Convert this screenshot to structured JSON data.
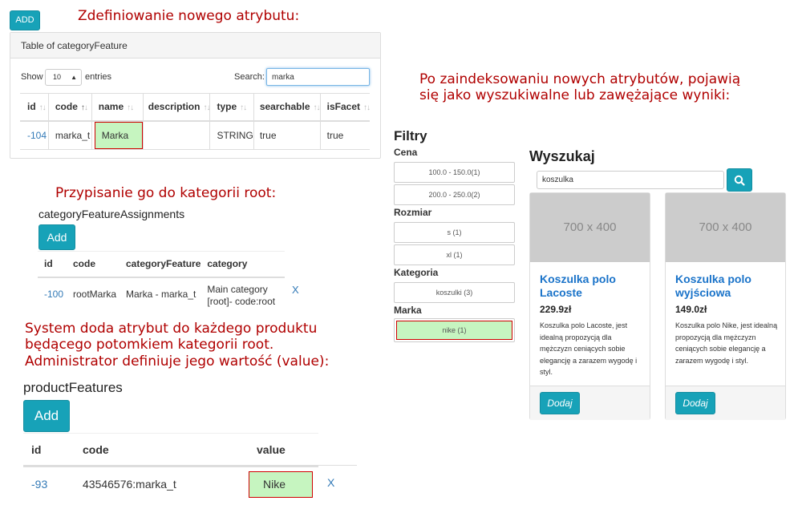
{
  "notes": {
    "define": "Zdefiniowanie nowego atrybutu:",
    "assign": "Przypisanie go do kategorii root:",
    "system_line1": "System doda atrybut do każdego produktu",
    "system_line2": "będącego potomkiem kategorii root.",
    "system_line3": "Administrator definiuje jego wartość (value):",
    "indexed_line1": "Po zaindeksowaniu nowych atrybutów, pojawią",
    "indexed_line2": "się jako wyszukiwalne lub zawężające wyniki:"
  },
  "category_feature": {
    "add_label": "ADD",
    "table_title": "Table of categoryFeature",
    "show_label": "Show",
    "entries_value": "10",
    "entries_label": "entries",
    "search_label": "Search:",
    "search_value": "marka",
    "columns": [
      "id",
      "code",
      "name",
      "description",
      "type",
      "searchable",
      "isFacet"
    ],
    "row": {
      "id": "-104",
      "code": "marka_t",
      "name": "Marka",
      "description": "",
      "type": "STRING",
      "searchable": "true",
      "isFacet": "true"
    }
  },
  "assignments": {
    "title": "categoryFeatureAssignments",
    "add_label": "Add",
    "columns": [
      "id",
      "code",
      "categoryFeature",
      "category"
    ],
    "row": {
      "id": "-100",
      "code": "rootMarka",
      "categoryFeature": "Marka - marka_t",
      "category_line1": "Main category",
      "category_line2": "[root]- code:root",
      "delete": "X"
    }
  },
  "product_features": {
    "title": "productFeatures",
    "add_label": "Add",
    "columns": [
      "id",
      "code",
      "value"
    ],
    "row": {
      "id": "-93",
      "code": "43546576:marka_t",
      "value": "Nike",
      "delete": "X"
    }
  },
  "filters": {
    "title": "Filtry",
    "groups": [
      {
        "name": "Cena",
        "options": [
          "100.0 - 150.0(1)",
          "200.0 - 250.0(2)"
        ]
      },
      {
        "name": "Rozmiar",
        "options": [
          "s (1)",
          "xl (1)"
        ]
      },
      {
        "name": "Kategoria",
        "options": [
          "koszulki (3)"
        ]
      },
      {
        "name": "Marka",
        "options": [
          "nike (1)"
        ]
      }
    ]
  },
  "search": {
    "title": "Wyszukaj",
    "query": "koszulka",
    "icon": "search-icon"
  },
  "products": [
    {
      "image_text": "700 x 400",
      "name": "Koszulka polo Lacoste",
      "price": "229.9zł",
      "description": "Koszulka polo Lacoste, jest idealną propozycją dla mężczyzn ceniących sobie elegancję a zarazem wygodę i styl.",
      "button": "Dodaj"
    },
    {
      "image_text": "700 x 400",
      "name": "Koszulka polo wyjściowa",
      "price": "149.0zł",
      "description": "Koszulka polo Nike, jest idealną propozycją dla mężczyzn ceniących sobie elegancję a zarazem wygodę i styl.",
      "button": "Dodaj"
    }
  ],
  "colors": {
    "teal": "#17a2b8",
    "highlight_fill": "#c6f5c0",
    "highlight_border": "#d00000",
    "note_text": "#b00000",
    "link": "#337ab7"
  }
}
